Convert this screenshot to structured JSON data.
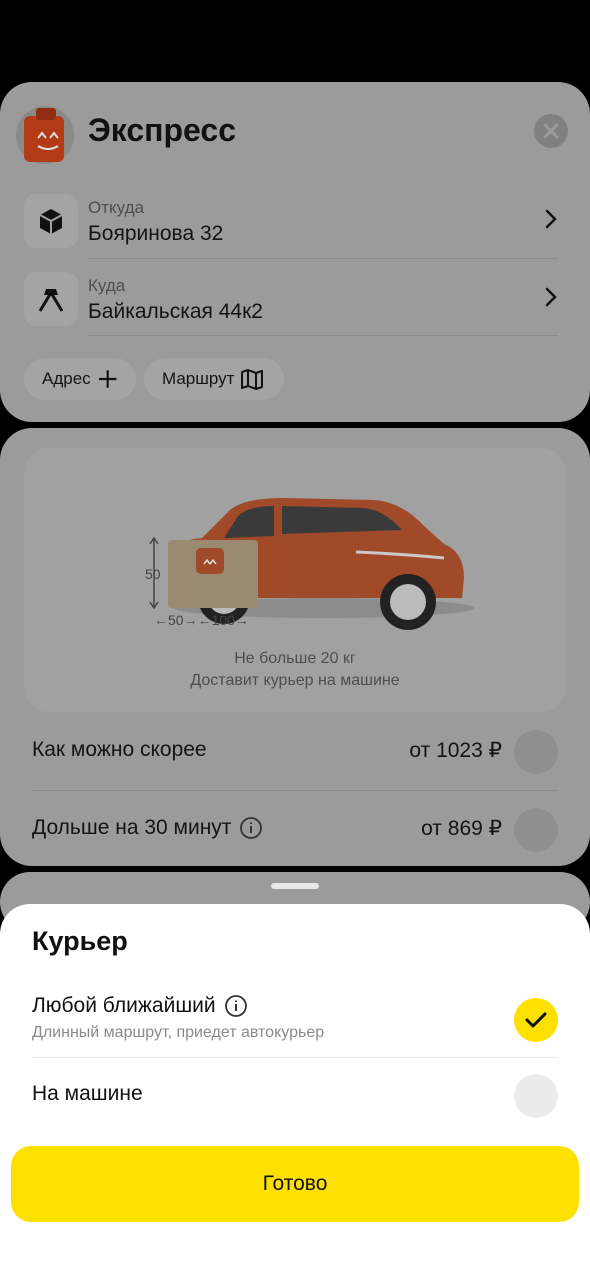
{
  "header": {
    "title": "Экспресс"
  },
  "route": {
    "from": {
      "label": "Откуда",
      "value": "Бояринова 32"
    },
    "to": {
      "label": "Куда",
      "value": "Байкальская 44к2"
    }
  },
  "actions": {
    "address_label": "Адрес",
    "route_label": "Маршрут"
  },
  "vehicle": {
    "dim_height": "50",
    "dim_width": "←50→←100→",
    "caption_line1": "Не больше 20 кг",
    "caption_line2": "Доставит курьер на машине"
  },
  "delivery_options": [
    {
      "label": "Как можно скорее",
      "price": "от 1023 ₽"
    },
    {
      "label": "Дольше на 30 минут",
      "price": "от 869 ₽"
    }
  ],
  "sheet": {
    "title": "Курьер",
    "options": [
      {
        "label": "Любой ближайший",
        "subtitle": "Длинный маршрут, приедет автокурьер",
        "selected": true
      },
      {
        "label": "На машине",
        "subtitle": "",
        "selected": false
      }
    ],
    "done_label": "Готово"
  },
  "colors": {
    "accent": "#FCE000",
    "brand": "#E84A1A"
  }
}
